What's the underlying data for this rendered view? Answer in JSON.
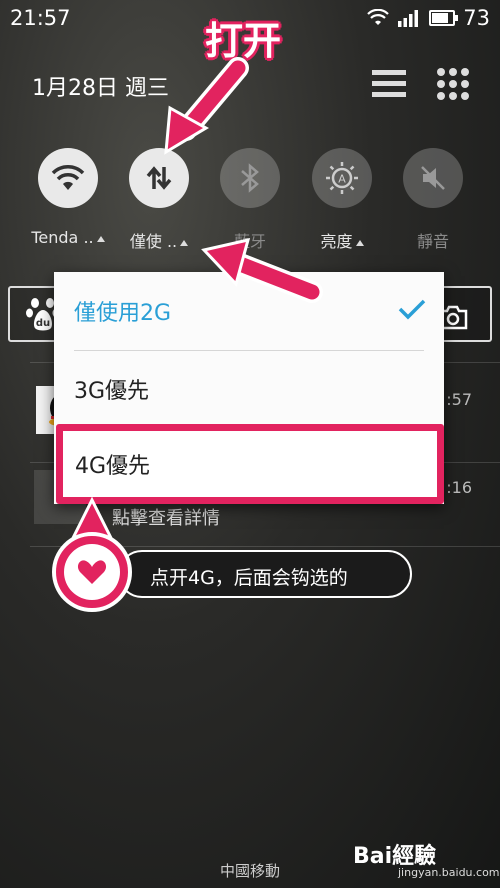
{
  "status_bar": {
    "time": "21:57",
    "battery": "73",
    "battery_level": 0.73
  },
  "header": {
    "date": "1月28日  週三"
  },
  "toggles": [
    {
      "label": "Tenda ..",
      "icon": "wifi-icon",
      "active": true
    },
    {
      "label": "僅使 ..",
      "icon": "mobile-data-icon",
      "active": true
    },
    {
      "label": "藍牙",
      "icon": "bluetooth-icon",
      "active": false
    },
    {
      "label": "亮度",
      "icon": "brightness-icon",
      "active": false
    },
    {
      "label": "靜音",
      "icon": "mute-icon",
      "active": false
    }
  ],
  "notifications": [
    {
      "time": ":57"
    },
    {
      "time": ":16",
      "text": "點擊查看詳情"
    }
  ],
  "menu": {
    "items": [
      {
        "label": "僅使用2G",
        "selected": true
      },
      {
        "label": "3G優先",
        "selected": false
      },
      {
        "label": "4G優先",
        "selected": false
      }
    ]
  },
  "annotations": {
    "title": "打开",
    "tooltip": "点开4G，后面会钩选的"
  },
  "footer": {
    "carrier": "中國移動",
    "watermark": "Bai經驗",
    "watermark_sub": "jingyan.baidu.com"
  },
  "colors": {
    "accent": "#e2235f",
    "selected": "#2a9fd6"
  }
}
